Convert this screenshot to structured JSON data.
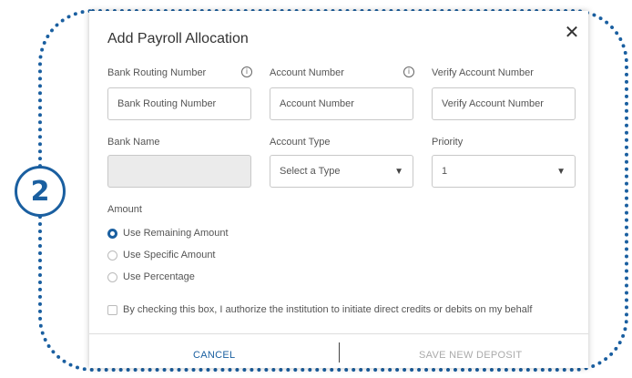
{
  "step_number": "2",
  "modal": {
    "title": "Add Payroll Allocation",
    "close_glyph": "✕"
  },
  "fields": {
    "routing": {
      "label": "Bank Routing Number",
      "placeholder": "Bank Routing Number",
      "info_glyph": "i"
    },
    "account": {
      "label": "Account Number",
      "placeholder": "Account Number",
      "info_glyph": "i"
    },
    "verify": {
      "label": "Verify Account Number",
      "placeholder": "Verify Account Number"
    },
    "bank_name": {
      "label": "Bank Name",
      "value": ""
    },
    "account_type": {
      "label": "Account Type",
      "selected": "Select a Type"
    },
    "priority": {
      "label": "Priority",
      "selected": "1"
    }
  },
  "amount": {
    "label": "Amount",
    "options": [
      {
        "label": "Use Remaining Amount",
        "checked": true
      },
      {
        "label": "Use Specific Amount",
        "checked": false
      },
      {
        "label": "Use Percentage",
        "checked": false
      }
    ]
  },
  "authorization": {
    "label": "By checking this box, I authorize the institution to initiate direct credits or debits on my behalf",
    "checked": false
  },
  "footer": {
    "cancel_label": "CANCEL",
    "save_label": "SAVE NEW DEPOSIT"
  },
  "colors": {
    "accent": "#1a5fa0",
    "disabled_text": "#aaaaaa"
  }
}
